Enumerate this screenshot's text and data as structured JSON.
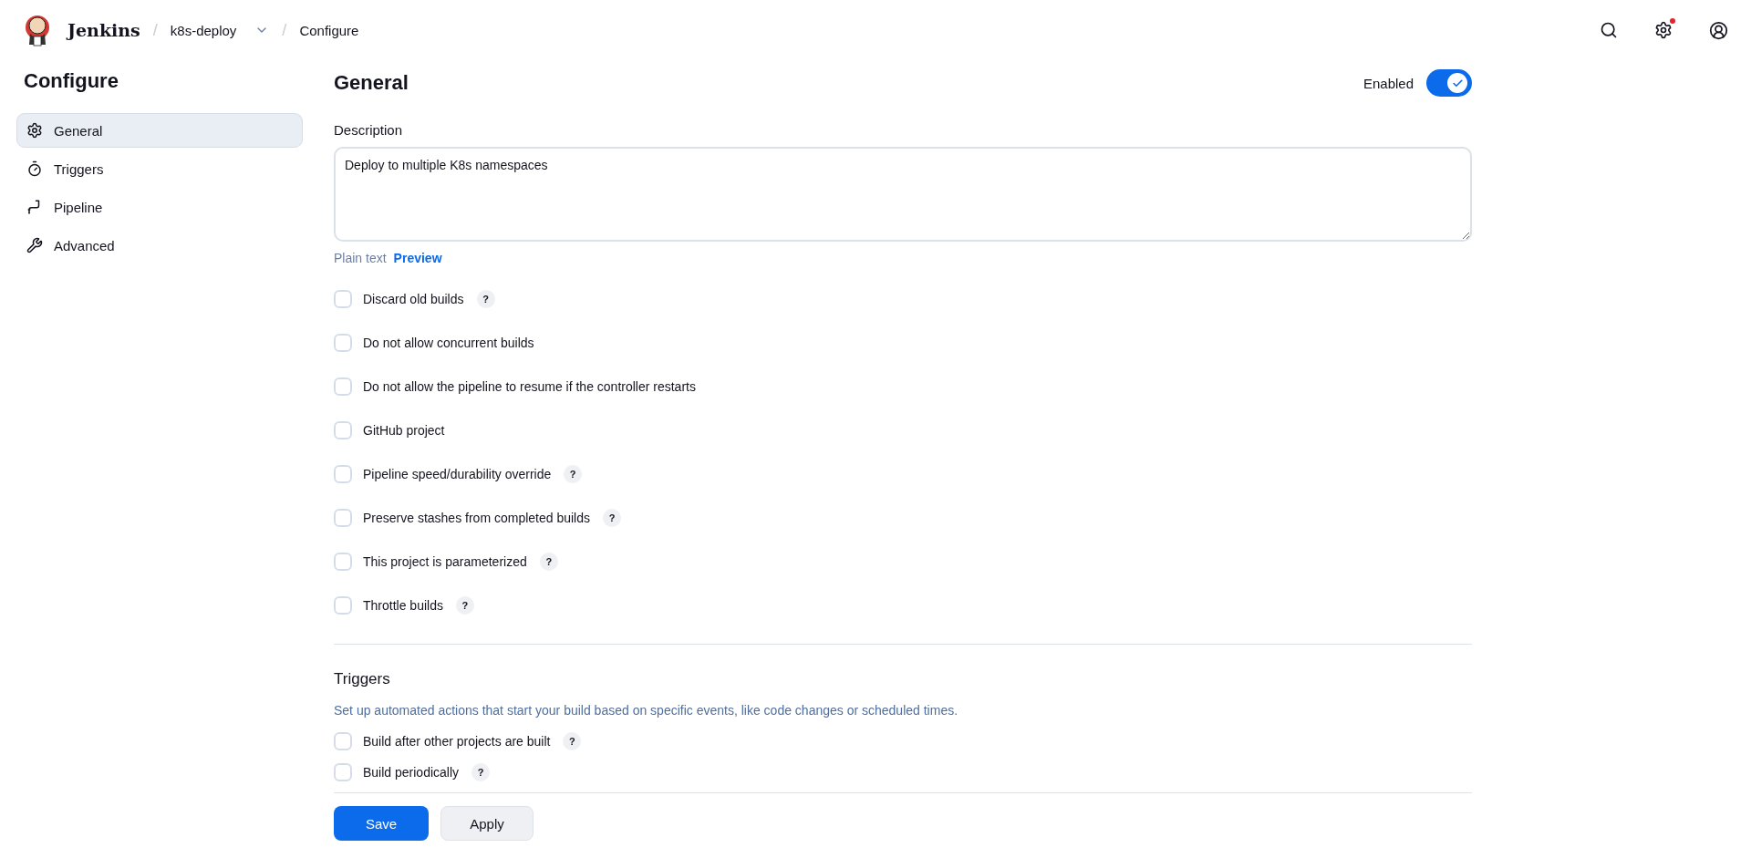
{
  "header": {
    "brand": "Jenkins",
    "breadcrumbs": [
      {
        "separator": "/",
        "label": "k8s-deploy",
        "dropdown": true
      },
      {
        "separator": "/",
        "label": "Configure"
      }
    ],
    "notification": true
  },
  "sidebar": {
    "title": "Configure",
    "items": [
      {
        "label": "General",
        "selected": true
      },
      {
        "label": "Triggers",
        "selected": false
      },
      {
        "label": "Pipeline",
        "selected": false
      },
      {
        "label": "Advanced",
        "selected": false
      }
    ]
  },
  "general": {
    "title": "General",
    "enabled_label": "Enabled",
    "enabled": true,
    "description_label": "Description",
    "description": "Deploy to multiple K8s namespaces",
    "format_links": [
      {
        "label": "Plain text",
        "selected": false
      },
      {
        "label": "Preview",
        "selected": true
      }
    ],
    "options": [
      {
        "label": "Discard old builds",
        "checked": false,
        "help": "?"
      },
      {
        "label": "Do not allow concurrent builds",
        "checked": false
      },
      {
        "label": "Do not allow the pipeline to resume if the controller restarts",
        "checked": false
      },
      {
        "label": "GitHub project",
        "checked": false
      },
      {
        "label": "Pipeline speed/durability override",
        "checked": false,
        "help": "?"
      },
      {
        "label": "Preserve stashes from completed builds",
        "checked": false,
        "help": "?"
      },
      {
        "label": "This project is parameterized",
        "checked": false,
        "help": "?"
      },
      {
        "label": "Throttle builds",
        "checked": false,
        "help": "?"
      }
    ]
  },
  "triggers": {
    "title": "Triggers",
    "description": "Set up automated actions that start your build based on specific events, like code changes or scheduled times.",
    "options": [
      {
        "label": "Build after other projects are built",
        "checked": false,
        "help": "?"
      },
      {
        "label": "Build periodically",
        "checked": false,
        "help": "?"
      }
    ]
  },
  "buttons": [
    {
      "label": "Save",
      "kind": "primary"
    },
    {
      "label": "Apply",
      "kind": "secondary"
    }
  ]
}
